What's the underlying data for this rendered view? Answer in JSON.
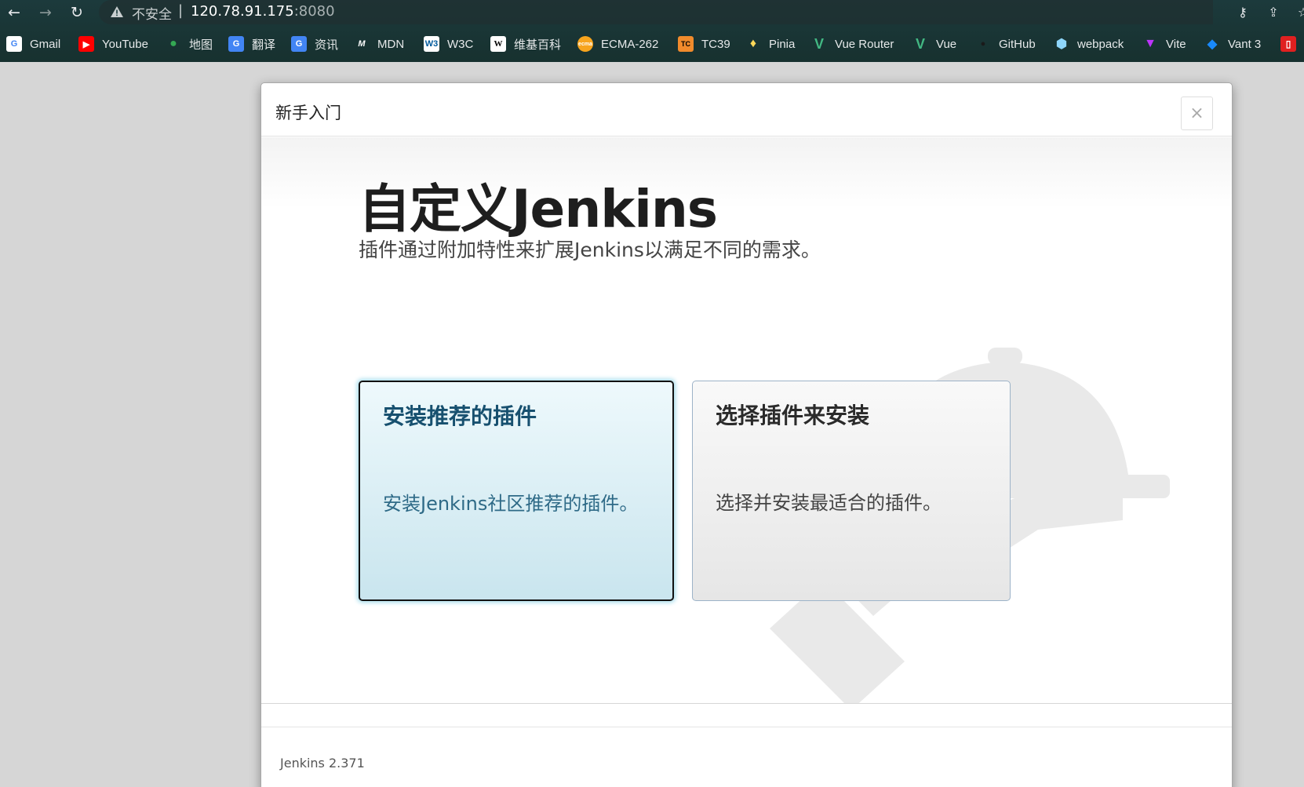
{
  "browser": {
    "security_label": "不安全",
    "url_host": "120.78.91.175",
    "url_port": ":8080",
    "bookmarks": [
      {
        "label": "Gmail",
        "icon": "google-icon",
        "color": "#ffffff"
      },
      {
        "label": "YouTube",
        "icon": "youtube-icon",
        "color": "#ff0000"
      },
      {
        "label": "地图",
        "icon": "maps-icon",
        "color": "#34a853"
      },
      {
        "label": "翻译",
        "icon": "translate-icon",
        "color": "#4285f4"
      },
      {
        "label": "资讯",
        "icon": "news-icon",
        "color": "#4285f4"
      },
      {
        "label": "MDN",
        "icon": "mdn-icon",
        "color": "#000000"
      },
      {
        "label": "W3C",
        "icon": "w3c-icon",
        "color": "#005a9c"
      },
      {
        "label": "维基百科",
        "icon": "wikipedia-icon",
        "color": "#ffffff"
      },
      {
        "label": "ECMA-262",
        "icon": "ecma-icon",
        "color": "#f7a41d"
      },
      {
        "label": "TC39",
        "icon": "tc39-icon",
        "color": "#f18b2c"
      },
      {
        "label": "Pinia",
        "icon": "pinia-icon",
        "color": "#ffd859"
      },
      {
        "label": "Vue Router",
        "icon": "vue-icon",
        "color": "#42b883"
      },
      {
        "label": "Vue",
        "icon": "vue-icon",
        "color": "#42b883"
      },
      {
        "label": "GitHub",
        "icon": "github-icon",
        "color": "#24292e"
      },
      {
        "label": "webpack",
        "icon": "webpack-icon",
        "color": "#8ed6fb"
      },
      {
        "label": "Vite",
        "icon": "vite-icon",
        "color": "#bd34fe"
      },
      {
        "label": "Vant 3",
        "icon": "vant-icon",
        "color": "#1989fa"
      }
    ]
  },
  "dialog": {
    "title": "新手入门",
    "close_label": "×",
    "heading": "自定义Jenkins",
    "subheading": "插件通过附加特性来扩展Jenkins以满足不同的需求。",
    "options": [
      {
        "title": "安装推荐的插件",
        "description": "安装Jenkins社区推荐的插件。",
        "selected": true
      },
      {
        "title": "选择插件来安装",
        "description": "选择并安装最适合的插件。",
        "selected": false
      }
    ],
    "footer_version": "Jenkins 2.371"
  },
  "colors": {
    "chrome_bg": "#1c3a3c",
    "page_bg": "#d6d6d6",
    "recommended_title": "#17506f",
    "recommended_focus": "#a5dceb"
  }
}
